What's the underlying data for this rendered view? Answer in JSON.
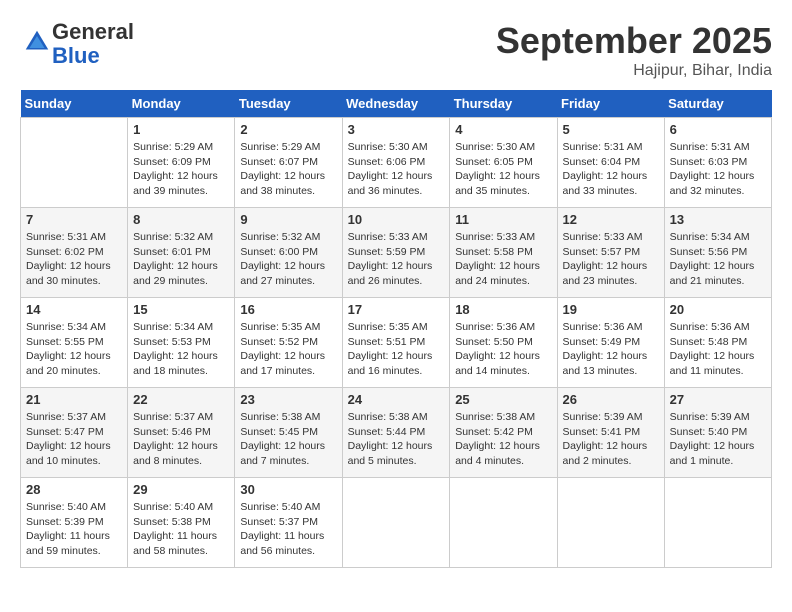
{
  "header": {
    "logo_line1": "General",
    "logo_line2": "Blue",
    "month": "September 2025",
    "location": "Hajipur, Bihar, India"
  },
  "weekdays": [
    "Sunday",
    "Monday",
    "Tuesday",
    "Wednesday",
    "Thursday",
    "Friday",
    "Saturday"
  ],
  "weeks": [
    [
      {
        "day": "",
        "info": ""
      },
      {
        "day": "1",
        "info": "Sunrise: 5:29 AM\nSunset: 6:09 PM\nDaylight: 12 hours\nand 39 minutes."
      },
      {
        "day": "2",
        "info": "Sunrise: 5:29 AM\nSunset: 6:07 PM\nDaylight: 12 hours\nand 38 minutes."
      },
      {
        "day": "3",
        "info": "Sunrise: 5:30 AM\nSunset: 6:06 PM\nDaylight: 12 hours\nand 36 minutes."
      },
      {
        "day": "4",
        "info": "Sunrise: 5:30 AM\nSunset: 6:05 PM\nDaylight: 12 hours\nand 35 minutes."
      },
      {
        "day": "5",
        "info": "Sunrise: 5:31 AM\nSunset: 6:04 PM\nDaylight: 12 hours\nand 33 minutes."
      },
      {
        "day": "6",
        "info": "Sunrise: 5:31 AM\nSunset: 6:03 PM\nDaylight: 12 hours\nand 32 minutes."
      }
    ],
    [
      {
        "day": "7",
        "info": "Sunrise: 5:31 AM\nSunset: 6:02 PM\nDaylight: 12 hours\nand 30 minutes."
      },
      {
        "day": "8",
        "info": "Sunrise: 5:32 AM\nSunset: 6:01 PM\nDaylight: 12 hours\nand 29 minutes."
      },
      {
        "day": "9",
        "info": "Sunrise: 5:32 AM\nSunset: 6:00 PM\nDaylight: 12 hours\nand 27 minutes."
      },
      {
        "day": "10",
        "info": "Sunrise: 5:33 AM\nSunset: 5:59 PM\nDaylight: 12 hours\nand 26 minutes."
      },
      {
        "day": "11",
        "info": "Sunrise: 5:33 AM\nSunset: 5:58 PM\nDaylight: 12 hours\nand 24 minutes."
      },
      {
        "day": "12",
        "info": "Sunrise: 5:33 AM\nSunset: 5:57 PM\nDaylight: 12 hours\nand 23 minutes."
      },
      {
        "day": "13",
        "info": "Sunrise: 5:34 AM\nSunset: 5:56 PM\nDaylight: 12 hours\nand 21 minutes."
      }
    ],
    [
      {
        "day": "14",
        "info": "Sunrise: 5:34 AM\nSunset: 5:55 PM\nDaylight: 12 hours\nand 20 minutes."
      },
      {
        "day": "15",
        "info": "Sunrise: 5:34 AM\nSunset: 5:53 PM\nDaylight: 12 hours\nand 18 minutes."
      },
      {
        "day": "16",
        "info": "Sunrise: 5:35 AM\nSunset: 5:52 PM\nDaylight: 12 hours\nand 17 minutes."
      },
      {
        "day": "17",
        "info": "Sunrise: 5:35 AM\nSunset: 5:51 PM\nDaylight: 12 hours\nand 16 minutes."
      },
      {
        "day": "18",
        "info": "Sunrise: 5:36 AM\nSunset: 5:50 PM\nDaylight: 12 hours\nand 14 minutes."
      },
      {
        "day": "19",
        "info": "Sunrise: 5:36 AM\nSunset: 5:49 PM\nDaylight: 12 hours\nand 13 minutes."
      },
      {
        "day": "20",
        "info": "Sunrise: 5:36 AM\nSunset: 5:48 PM\nDaylight: 12 hours\nand 11 minutes."
      }
    ],
    [
      {
        "day": "21",
        "info": "Sunrise: 5:37 AM\nSunset: 5:47 PM\nDaylight: 12 hours\nand 10 minutes."
      },
      {
        "day": "22",
        "info": "Sunrise: 5:37 AM\nSunset: 5:46 PM\nDaylight: 12 hours\nand 8 minutes."
      },
      {
        "day": "23",
        "info": "Sunrise: 5:38 AM\nSunset: 5:45 PM\nDaylight: 12 hours\nand 7 minutes."
      },
      {
        "day": "24",
        "info": "Sunrise: 5:38 AM\nSunset: 5:44 PM\nDaylight: 12 hours\nand 5 minutes."
      },
      {
        "day": "25",
        "info": "Sunrise: 5:38 AM\nSunset: 5:42 PM\nDaylight: 12 hours\nand 4 minutes."
      },
      {
        "day": "26",
        "info": "Sunrise: 5:39 AM\nSunset: 5:41 PM\nDaylight: 12 hours\nand 2 minutes."
      },
      {
        "day": "27",
        "info": "Sunrise: 5:39 AM\nSunset: 5:40 PM\nDaylight: 12 hours\nand 1 minute."
      }
    ],
    [
      {
        "day": "28",
        "info": "Sunrise: 5:40 AM\nSunset: 5:39 PM\nDaylight: 11 hours\nand 59 minutes."
      },
      {
        "day": "29",
        "info": "Sunrise: 5:40 AM\nSunset: 5:38 PM\nDaylight: 11 hours\nand 58 minutes."
      },
      {
        "day": "30",
        "info": "Sunrise: 5:40 AM\nSunset: 5:37 PM\nDaylight: 11 hours\nand 56 minutes."
      },
      {
        "day": "",
        "info": ""
      },
      {
        "day": "",
        "info": ""
      },
      {
        "day": "",
        "info": ""
      },
      {
        "day": "",
        "info": ""
      }
    ]
  ]
}
